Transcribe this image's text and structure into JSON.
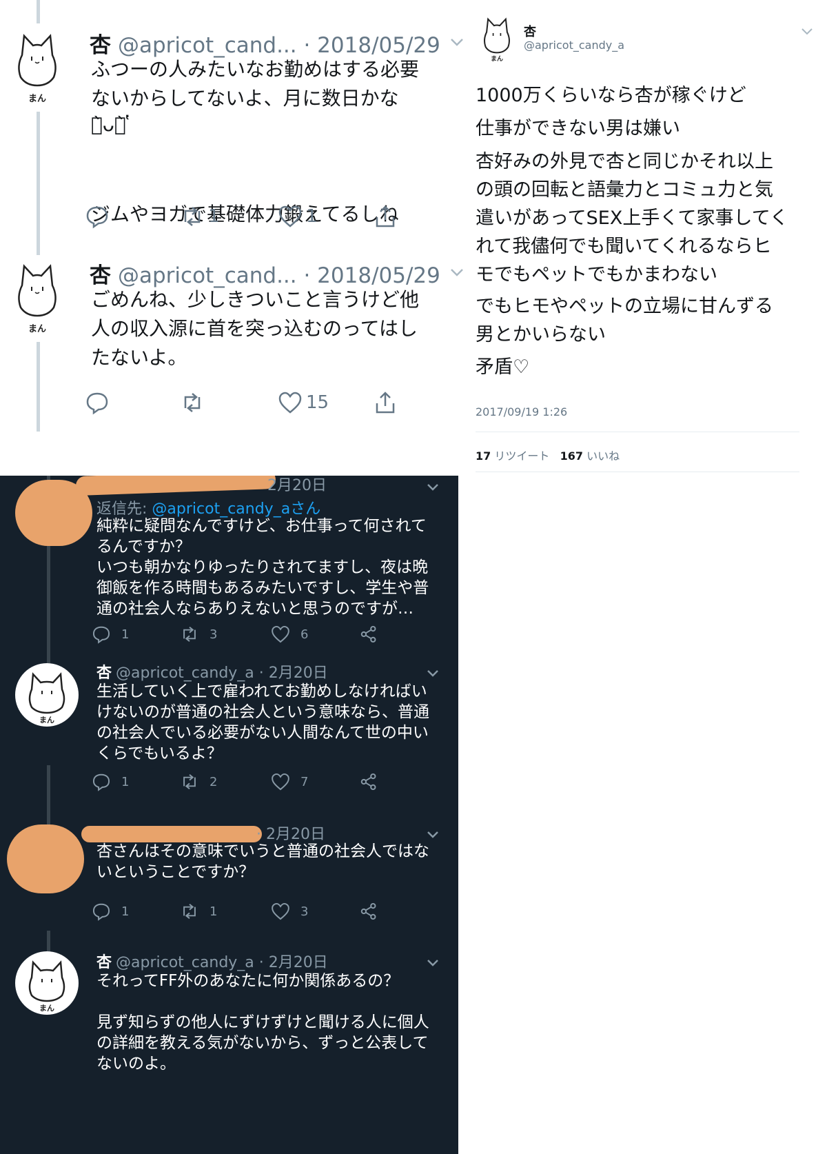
{
  "colors": {
    "light_bg": "#ffffff",
    "dark_bg": "#15202b",
    "mention": "#1da1f2",
    "redaction": "#e8a36b"
  },
  "avatar": {
    "label": "まん",
    "icon": "cat-outline-icon"
  },
  "light_thread": {
    "tweets": [
      {
        "name": "杏",
        "meta": "@apricot_cand... · 2018/05/29",
        "body": "ふつーの人みたいなお勤めはする必要\nないからしてないよ、月に数日かな\n\n\n\nジムやヨガで基礎体力鍛えてるしね",
        "emoticon": "ก̀ᴗก̀ ̔",
        "replies": "",
        "retweets": "1",
        "likes": "1"
      },
      {
        "name": "杏",
        "meta": "@apricot_cand... · 2018/05/29",
        "body": "ごめんね、少しきついこと言うけど他\n人の収入源に首を突っ込むのってはし\nたないよ。",
        "replies": "",
        "retweets": "",
        "likes": "15"
      }
    ]
  },
  "detail": {
    "name": "杏",
    "handle": "@apricot_candy_a",
    "paragraphs": [
      "1000万くらいなら杏が稼ぐけど",
      "仕事ができない男は嫌い",
      "杏好みの外見で杏と同じかそれ以上\nの頭の回転と語彙力とコミュ力と気\n遣いがあってSEX上手くて家事してく\nれて我儘何でも聞いてくれるならヒ\nモでもペットでもかまわない",
      "でもヒモやペットの立場に甘んずる\n男とかいらない",
      "矛盾♡"
    ],
    "timestamp": "2017/09/19 1:26",
    "retweet_count": "17",
    "retweet_label": "リツイート",
    "like_count": "167",
    "like_label": "いいね"
  },
  "dark_thread": {
    "tweets": [
      {
        "name": "",
        "meta": "2月20日",
        "reply_prefix": "返信先: ",
        "reply_mention": "@apricot_candy_a",
        "reply_suffix": "さん",
        "body": "純粋に疑問なんですけど、お仕事って何されて\nるんですか？\nいつも朝かなりゆったりされてますし、夜は晩\n御飯を作る時間もあるみたいですし、学生や普\n通の社会人ならありえないと思うのですが…",
        "replies": "1",
        "retweets": "3",
        "likes": "6"
      },
      {
        "name": "杏",
        "meta": "@apricot_candy_a · 2月20日",
        "body": "生活していく上で雇われてお勤めしなければい\nけないのが普通の社会人という意味なら、普通\nの社会人でいる必要がない人間なんて世の中い\nくらでもいるよ？",
        "replies": "1",
        "retweets": "2",
        "likes": "7"
      },
      {
        "name": "",
        "meta": "· 2月20日",
        "body": "杏さんはその意味でいうと普通の社会人ではな\nいということですか？",
        "replies": "1",
        "retweets": "1",
        "likes": "3"
      },
      {
        "name": "杏",
        "meta": "@apricot_candy_a · 2月20日",
        "body": "それってFF外のあなたに何か関係あるの？\n\n見ず知らずの他人にずけずけと聞ける人に個人\nの詳細を教える気がないから、ずっと公表して\nないのよ。"
      }
    ]
  }
}
